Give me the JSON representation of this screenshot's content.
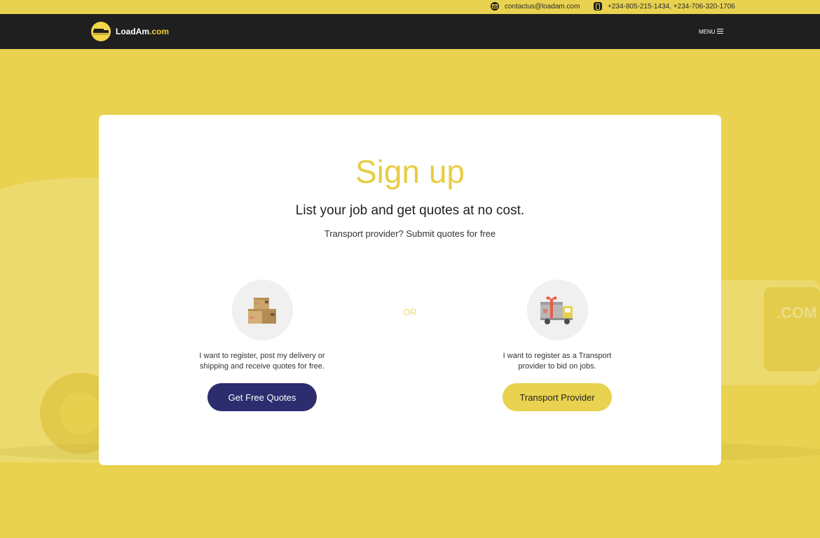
{
  "topbar": {
    "email": "contactus@loadam.com",
    "phones": "+234-805-215-1434, +234-706-320-1706"
  },
  "nav": {
    "logo_main": "LoadAm",
    "logo_suffix": ".com",
    "menu_label": "MENU"
  },
  "signup": {
    "title": "Sign up",
    "subtitle": "List your job and get quotes at no cost.",
    "provider_note": "Transport provider? Submit quotes for free",
    "or_label": "OR",
    "customer": {
      "description_line1": "I want to register, post my delivery or",
      "description_line2": "shipping and receive quotes for free.",
      "button_label": "Get Free Quotes"
    },
    "provider": {
      "description_line1": "I want to register as a Transport",
      "description_line2": "provider to bid on jobs.",
      "button_label": "Transport Provider"
    }
  },
  "icons": {
    "email": "envelope-icon",
    "phone": "phone-icon",
    "menu": "hamburger-icon",
    "customer": "boxes-icon",
    "provider": "delivery-truck-icon"
  },
  "colors": {
    "background": "#e9d24f",
    "navbar": "#1f1f1f",
    "accent": "#e8cd42",
    "primary_button": "#2b2d6e"
  }
}
